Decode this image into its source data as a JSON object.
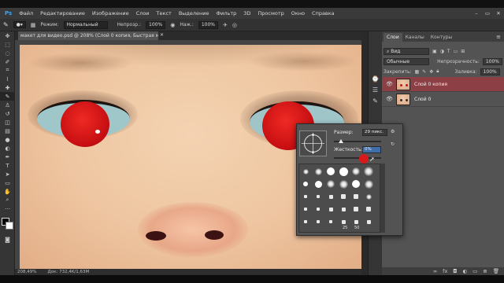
{
  "menu": {
    "logo": "Ps",
    "items": [
      "Файл",
      "Редактирование",
      "Изображение",
      "Слои",
      "Текст",
      "Выделение",
      "Фильтр",
      "3D",
      "Просмотр",
      "Окно",
      "Справка"
    ]
  },
  "options": {
    "mode_label": "Режим:",
    "mode_value": "Нормальный",
    "opacity_label": "Непрозр.:",
    "opacity_value": "100%",
    "flow_label": "Наж.:",
    "flow_value": "100%"
  },
  "document": {
    "tab_title": "макет для видео.psd @ 208% (Слой 0 копия, Быстрая маска/8) *",
    "zoom": "208,49%",
    "doc_info": "Док: 732,4K/1,63M"
  },
  "panel": {
    "tabs": [
      "Слои",
      "Каналы",
      "Контуры"
    ],
    "filter_kind": "Вид",
    "blend_mode": "Обычные",
    "opacity_label": "Непрозрачность:",
    "opacity_value": "100%",
    "lock_label": "Закрепить:",
    "fill_label": "Заливка:",
    "fill_value": "100%",
    "layers": [
      {
        "name": "Слой 0 копия",
        "selected": true
      },
      {
        "name": "Слой 0",
        "selected": false
      }
    ],
    "footer_icons": [
      "link-icon",
      "fx-icon",
      "mask-icon",
      "adjustment-icon",
      "folder-icon",
      "new-layer-icon",
      "trash-icon"
    ]
  },
  "brush_picker": {
    "size_label": "Размер:",
    "size_value": "29 пикс.",
    "hardness_label": "Жесткость:",
    "hardness_value": "0%",
    "numbers_row": [
      "25",
      "50"
    ]
  },
  "colors": {
    "accent_selected_layer": "#8c3f44",
    "eye_red": "#d0161a"
  }
}
